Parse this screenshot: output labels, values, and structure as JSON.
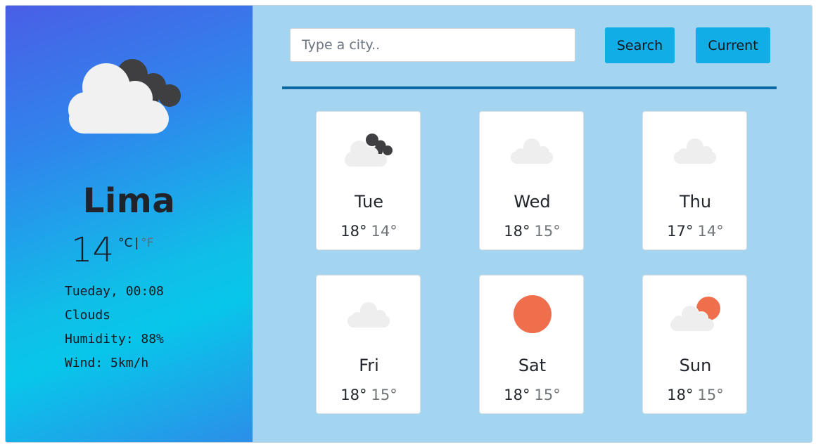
{
  "current": {
    "icon": "cloud-dark-cloud-icon",
    "city": "Lima",
    "temperature": "14",
    "unit_c": "°C",
    "unit_separator": "|",
    "unit_f": "°F",
    "datetime": "Tueday, 00:08",
    "description": "Clouds",
    "humidity": "Humidity: 88%",
    "wind": "Wind: 5km/h"
  },
  "search": {
    "placeholder": "Type a city..",
    "value": "",
    "search_label": "Search",
    "current_label": "Current"
  },
  "colors": {
    "panel_gradient_top": "#4a5ee6",
    "panel_gradient_mid": "#08c6ea",
    "main_background": "#a3d5f1",
    "button": "#10ade6",
    "divider": "#0a6aa1",
    "sun": "#ef6f4d",
    "cloud_light": "#eeeeee",
    "cloud_dark": "#3f3f42"
  },
  "forecast": [
    {
      "day": "Tue",
      "high": "18°",
      "low": "14°",
      "icon": "cloud-dark-cloud-icon"
    },
    {
      "day": "Wed",
      "high": "18°",
      "low": "15°",
      "icon": "cloud-icon"
    },
    {
      "day": "Thu",
      "high": "17°",
      "low": "14°",
      "icon": "cloud-icon"
    },
    {
      "day": "Fri",
      "high": "18°",
      "low": "15°",
      "icon": "cloud-icon"
    },
    {
      "day": "Sat",
      "high": "18°",
      "low": "15°",
      "icon": "sun-icon"
    },
    {
      "day": "Sun",
      "high": "18°",
      "low": "15°",
      "icon": "sun-cloud-icon"
    }
  ]
}
